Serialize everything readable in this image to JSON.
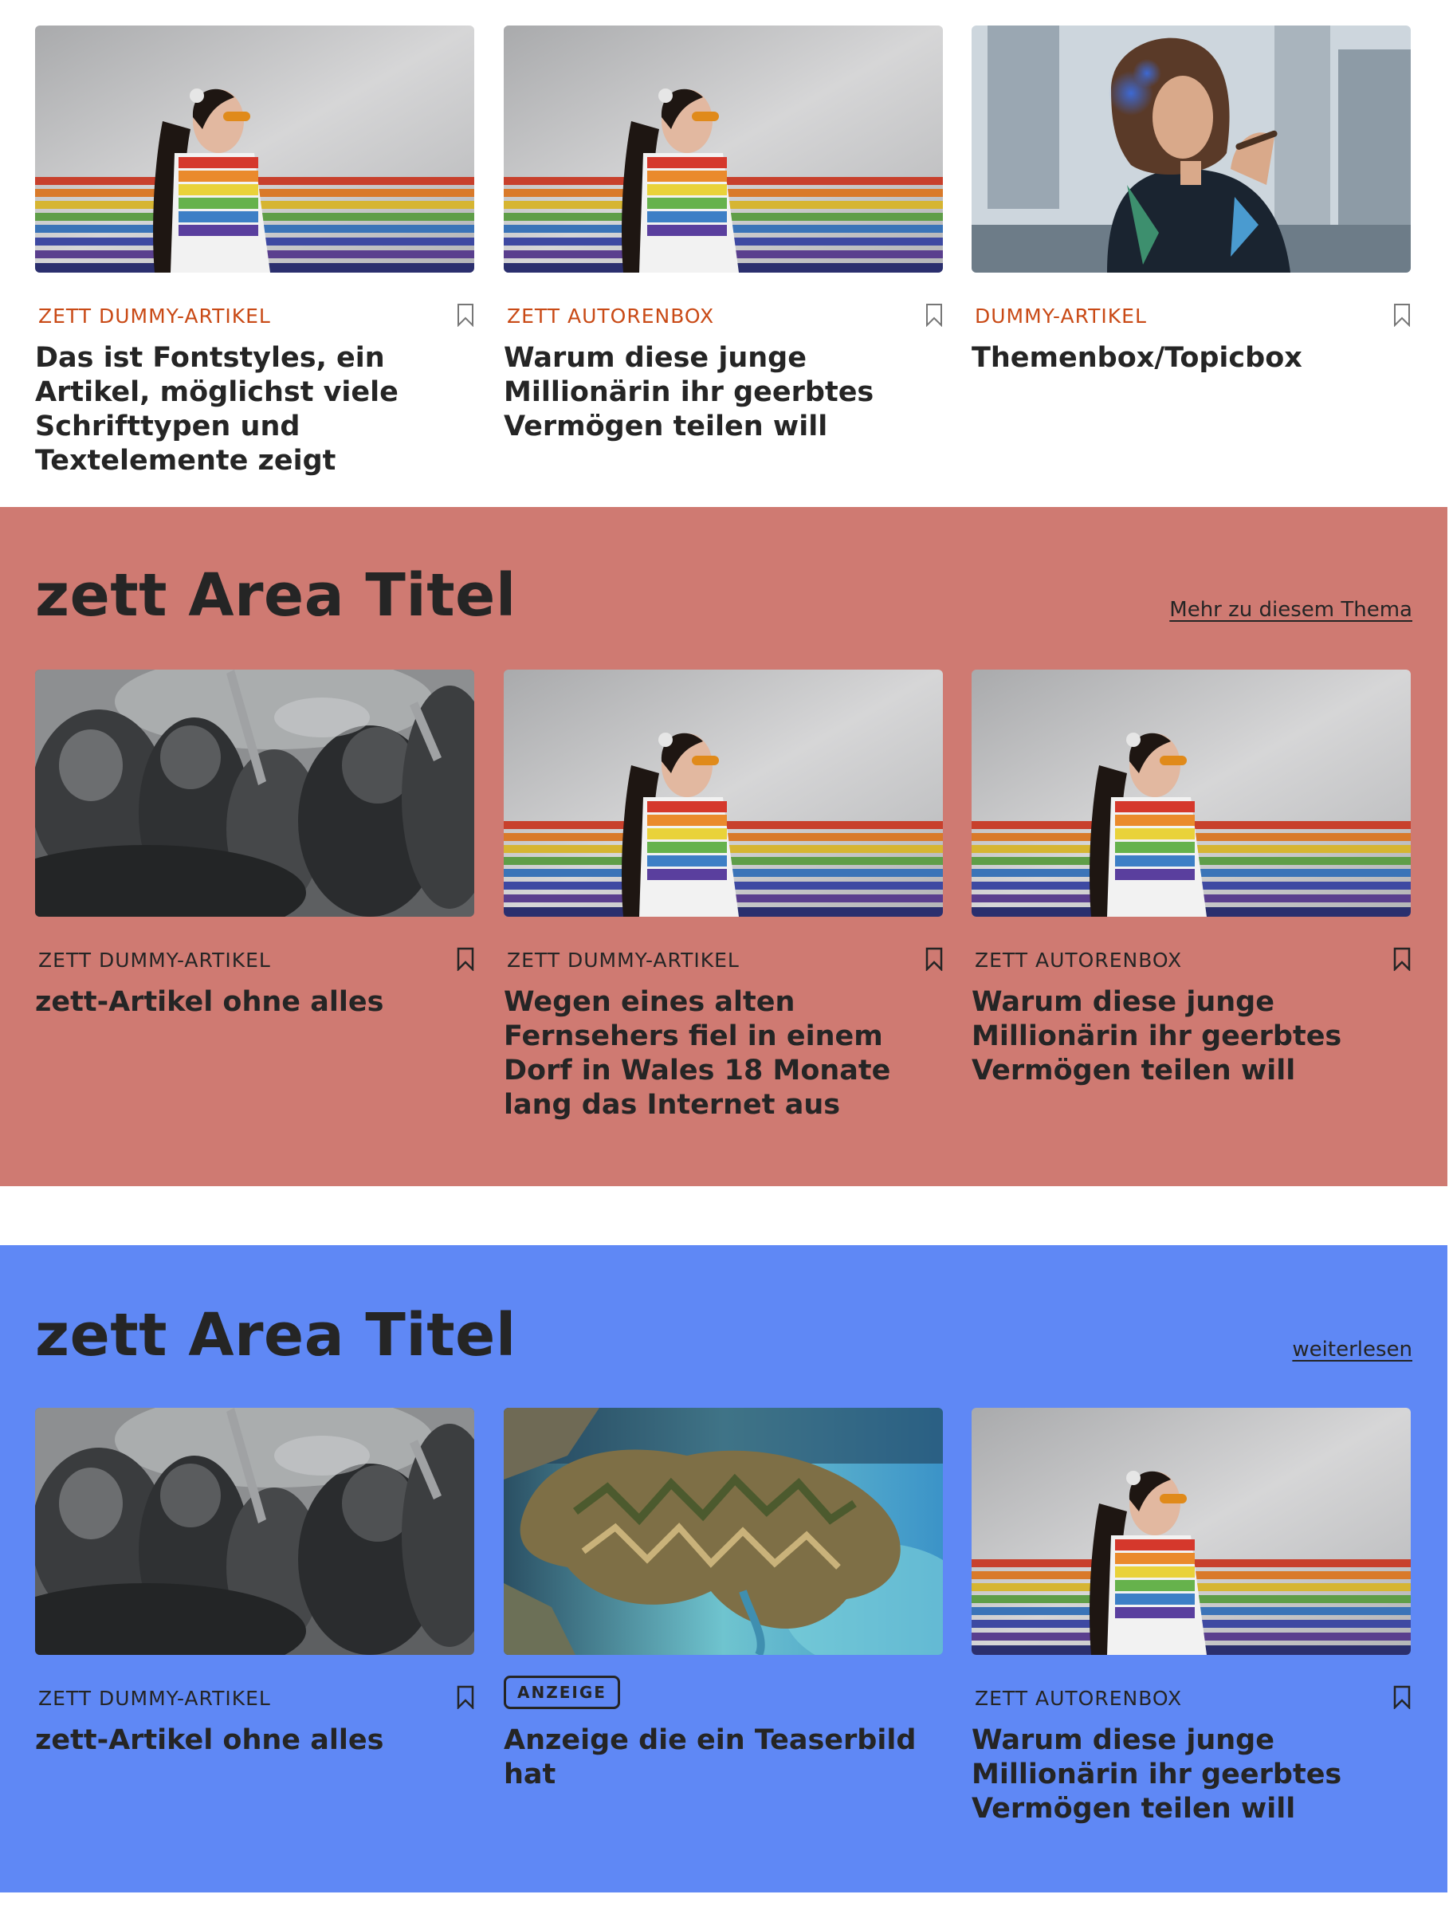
{
  "colors": {
    "section2_bg": "#cf7a72",
    "section3_bg": "#5f88f5",
    "kicker_orange": "#c94a16",
    "text_dark": "#252525"
  },
  "section1": {
    "cards": [
      {
        "image": "rainbow-stripes-woman-photo",
        "kicker": "ZETT DUMMY-ARTIKEL",
        "headline": "Das ist Fontstyles, ein Artikel, möglichst viele Schrifttypen und Textelemente zeigt"
      },
      {
        "image": "rainbow-stripes-woman-photo",
        "kicker": "ZETT AUTORENBOX",
        "headline": "Warum diese junge Millionärin ihr geerbtes Vermögen teilen will"
      },
      {
        "image": "woman-smoking-city-photo",
        "kicker": "DUMMY-ARTIKEL",
        "headline": "Themenbox/Topicbox"
      }
    ]
  },
  "section2": {
    "title": "zett Area Titel",
    "link": "Mehr zu diesem Thema",
    "cards": [
      {
        "image": "armored-knights-battle-photo",
        "kicker": "ZETT DUMMY-ARTIKEL",
        "headline": "zett-Artikel ohne alles"
      },
      {
        "image": "rainbow-stripes-woman-photo",
        "kicker": "ZETT DUMMY-ARTIKEL",
        "headline": "Wegen eines alten Fernsehers fiel in einem Dorf in Wales 18 Monate lang das Internet aus"
      },
      {
        "image": "rainbow-stripes-woman-photo",
        "kicker": "ZETT AUTORENBOX",
        "headline": "Warum diese junge Millionärin ihr geerbtes Vermögen teilen will"
      }
    ]
  },
  "section3": {
    "title": "zett Area Titel",
    "link": "weiterlesen",
    "cards": [
      {
        "image": "armored-knights-battle-photo",
        "kicker": "ZETT DUMMY-ARTIKEL",
        "headline": "zett-Artikel ohne alles"
      },
      {
        "image": "satellite-island-photo",
        "badge": "ANZEIGE",
        "headline": "Anzeige die ein Teaserbild hat"
      },
      {
        "image": "rainbow-stripes-woman-photo",
        "kicker": "ZETT AUTORENBOX",
        "headline": "Warum diese junge Millionärin ihr geerbtes Vermögen teilen will"
      }
    ]
  }
}
